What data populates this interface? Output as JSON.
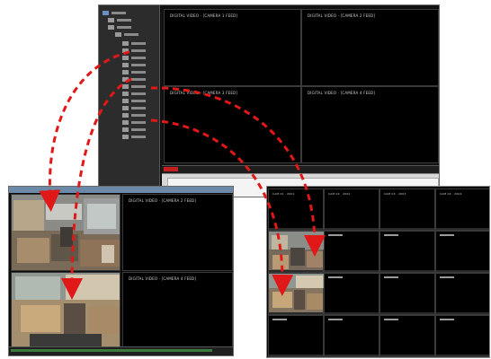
{
  "main_window": {
    "cells": [
      {
        "label": "DIGITAL VIDEO · [CAMERA 1 FEED]"
      },
      {
        "label": "DIGITAL VIDEO · [CAMERA 2 FEED]"
      },
      {
        "label": "DIGITAL VIDEO · [CAMERA 3 FEED]"
      },
      {
        "label": "DIGITAL VIDEO · [CAMERA 4 FEED]"
      }
    ]
  },
  "left_window": {
    "cells": [
      {
        "label": "DIGITAL VIDEO · [CAMERA 2 FEED]"
      },
      {
        "label": "DIGITAL VIDEO · [CAMERA 4 FEED]"
      }
    ]
  },
  "right_window": {
    "top_labels": [
      "CAM 01 · 2001",
      "CAM 02 · 2002",
      "CAM 03 · 2003",
      "CAM 04 · 2004"
    ]
  },
  "colors": {
    "arrow": "#e01818",
    "titlebar": "#6c89a8",
    "status_red": "#c42020"
  }
}
